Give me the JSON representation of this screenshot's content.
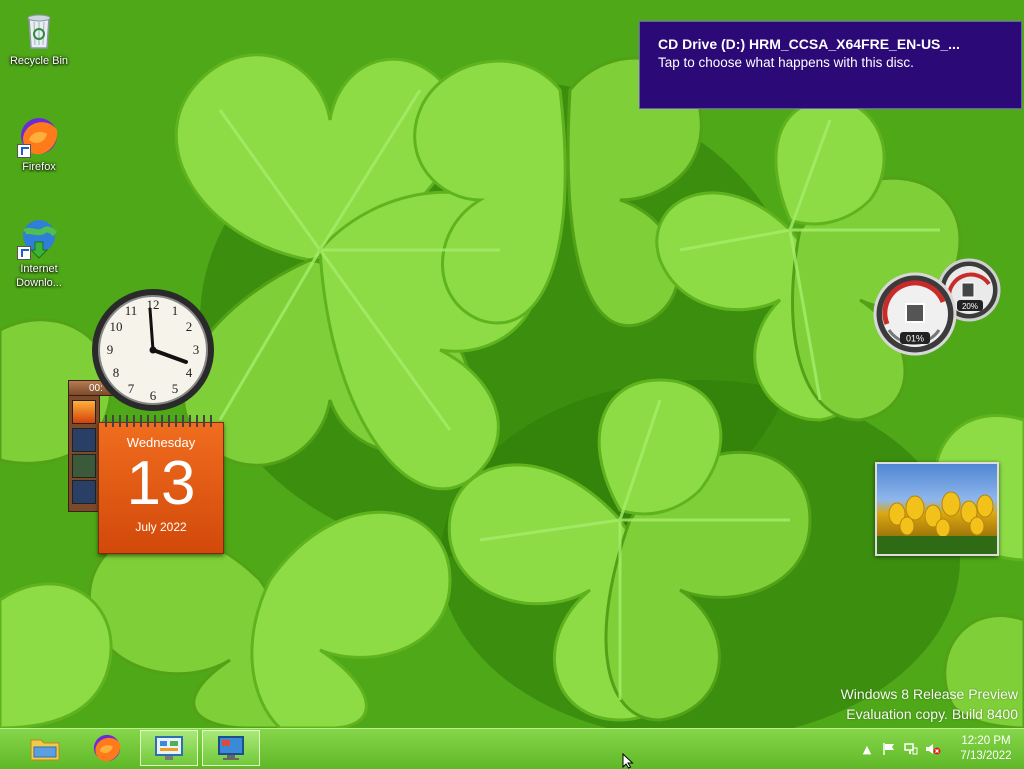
{
  "desktop": {
    "icons": [
      {
        "label": "Recycle Bin"
      },
      {
        "label": "Firefox"
      },
      {
        "label": "Internet Downlo..."
      }
    ]
  },
  "toast": {
    "title": "CD Drive (D:) HRM_CCSA_X64FRE_EN-US_...",
    "body": "Tap to choose what happens with this disc."
  },
  "gadgets": {
    "calendar": {
      "day_name": "Wednesday",
      "day": "13",
      "month_year": "July 2022"
    },
    "feed_label": "00:",
    "cpu_meter": {
      "cpu": "01%",
      "memory": "20%"
    }
  },
  "watermark": {
    "line1": "Windows 8 Release Preview",
    "line2": "Evaluation copy. Build 8400"
  },
  "taskbar": {
    "time": "12:20 PM",
    "date": "7/13/2022"
  },
  "colors": {
    "toast_bg": "#2b0a78",
    "taskbar": "#6fc435",
    "calendar": "#e35d14"
  }
}
